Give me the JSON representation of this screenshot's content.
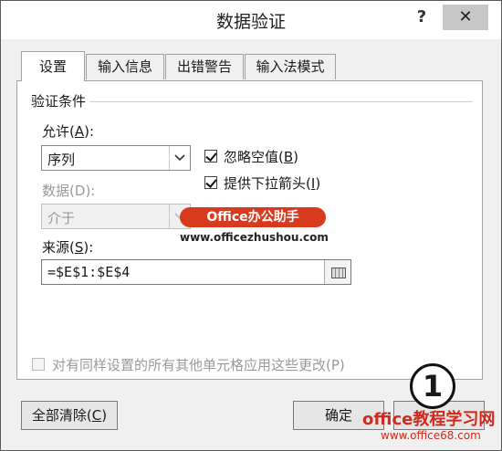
{
  "window": {
    "title": "数据验证",
    "help": "?",
    "close": "✕"
  },
  "tabs": [
    {
      "label": "设置",
      "active": true
    },
    {
      "label": "输入信息",
      "active": false
    },
    {
      "label": "出错警告",
      "active": false
    },
    {
      "label": "输入法模式",
      "active": false
    }
  ],
  "validation": {
    "group_title": "验证条件",
    "allow": {
      "label": "允许",
      "key": "A",
      "value": "序列"
    },
    "data": {
      "label": "数据",
      "key": "D",
      "value": "介于",
      "disabled": true
    },
    "ignore_blank": {
      "label": "忽略空值",
      "key": "B",
      "checked": true
    },
    "dropdown": {
      "label": "提供下拉箭头",
      "key": "I",
      "checked": true
    },
    "source": {
      "label": "来源",
      "key": "S",
      "value": "=$E$1:$E$4"
    }
  },
  "apply_all": {
    "label": "对有同样设置的所有其他单元格应用这些更改",
    "key": "P",
    "checked": false
  },
  "buttons": {
    "clear_all": "全部清除",
    "clear_key": "C",
    "ok": "确定"
  },
  "watermarks": {
    "brand": "Office办公助手",
    "url": "www.officezhushou.com",
    "step": "1",
    "site": "office教程学习网",
    "site_url": "www.office68.com"
  },
  "colors": {
    "watermark_red": "#d83a1e",
    "dialog_bg": "#f0f0f0"
  }
}
